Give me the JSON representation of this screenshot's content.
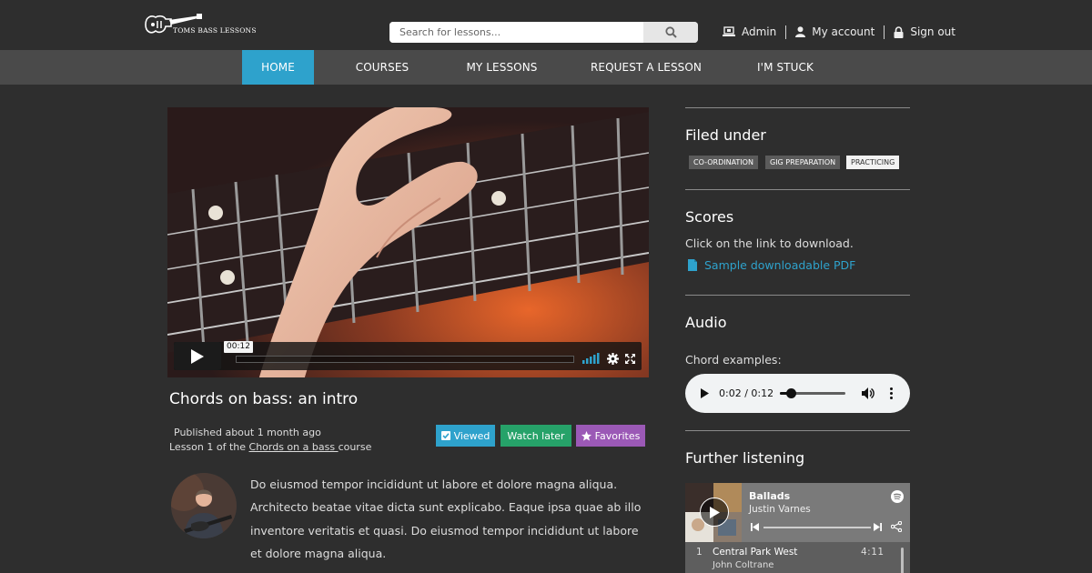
{
  "brand": {
    "name": "TOMS BASS LESSONS"
  },
  "search": {
    "placeholder": "Search for lessons..."
  },
  "toplinks": [
    {
      "label": "Admin",
      "icon": "laptop-icon"
    },
    {
      "label": "My account",
      "icon": "user-icon"
    },
    {
      "label": "Sign out",
      "icon": "lock-icon"
    }
  ],
  "nav": [
    {
      "label": "HOME",
      "active": true
    },
    {
      "label": "COURSES"
    },
    {
      "label": "MY LESSONS"
    },
    {
      "label": "REQUEST A LESSON"
    },
    {
      "label": "I'M STUCK"
    }
  ],
  "video": {
    "time": "00:12",
    "progress": 0
  },
  "lesson": {
    "title": "Chords on bass: an intro",
    "published": "Published about 1 month ago",
    "lesson_prefix": "Lesson 1 of the ",
    "course_link": "Chords on a bass ",
    "course_suffix": "course",
    "body": "Do eiusmod tempor incididunt ut labore et dolore magna aliqua. Architecto beatae vitae dicta sunt explicabo. Eaque ipsa quae ab illo inventore veritatis et quasi. Do eiusmod tempor incididunt ut labore et dolore magna aliqua."
  },
  "actions": {
    "viewed": "Viewed",
    "watch_later": "Watch later",
    "favorites": "Favorites"
  },
  "colors": {
    "accent": "#2ea2cc",
    "viewed": "#2ea2cc",
    "watch_later": "#26a269",
    "favorites": "#9b59b6"
  },
  "sidebar": {
    "filed_under": {
      "heading": "Filed under",
      "tags": [
        "CO-ORDINATION",
        "GIG PREPARATION",
        "PRACTICING"
      ]
    },
    "scores": {
      "heading": "Scores",
      "text": "Click on the link to download.",
      "link": "Sample downloadable PDF"
    },
    "audio": {
      "heading": "Audio",
      "label": "Chord examples:",
      "time": "0:02 / 0:12",
      "progress": 0.167
    },
    "further": {
      "heading": "Further listening",
      "album": "Ballads",
      "artist": "Justin Varnes",
      "track_no": "1",
      "track": "Central Park West",
      "track_artist": "John Coltrane",
      "duration": "4:11"
    }
  }
}
